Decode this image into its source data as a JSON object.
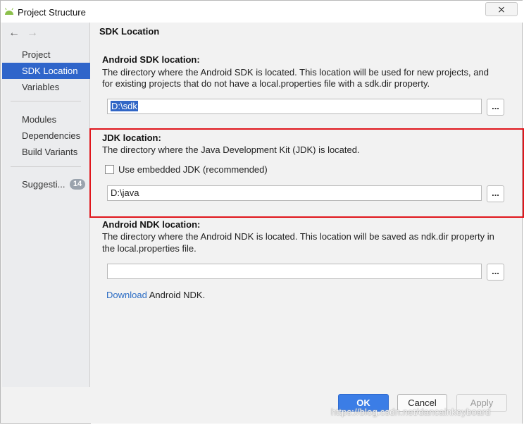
{
  "window": {
    "title": "Project Structure",
    "close_symbol": "⨯"
  },
  "nav": {
    "back_symbol": "←",
    "forward_symbol": "→"
  },
  "sidebar": {
    "items": [
      {
        "label": "Project"
      },
      {
        "label": "SDK Location"
      },
      {
        "label": "Variables"
      },
      {
        "label": "Modules"
      },
      {
        "label": "Dependencies"
      },
      {
        "label": "Build Variants"
      },
      {
        "label": "Suggesti..."
      }
    ],
    "suggestions_count": "14"
  },
  "main": {
    "section_title": "SDK Location",
    "android_sdk": {
      "heading": "Android SDK location:",
      "desc_line1": "The directory where the Android SDK is located. This location will be used for new projects, and",
      "desc_line2": "for existing projects that do not have a local.properties file with a sdk.dir property.",
      "value": "D:\\sdk",
      "browse_label": "..."
    },
    "jdk": {
      "heading": "JDK location:",
      "desc": "The directory where the Java Development Kit (JDK) is located.",
      "checkbox_label": "Use embedded JDK (recommended)",
      "value": "D:\\java",
      "browse_label": "..."
    },
    "ndk": {
      "heading": "Android NDK location:",
      "desc_line1": "The directory where the Android NDK is located. This location will be saved as ndk.dir property in",
      "desc_line2": "the local.properties file.",
      "value": "",
      "browse_label": "...",
      "download_link": "Download",
      "download_suffix": "Android NDK."
    }
  },
  "footer": {
    "ok": "OK",
    "cancel": "Cancel",
    "apply": "Apply"
  },
  "watermark": "https://blog.csdn.net/dancainkeyboard",
  "colors": {
    "accent": "#2f65ca",
    "highlight_border": "#e0161c",
    "link": "#2b6cc4"
  }
}
